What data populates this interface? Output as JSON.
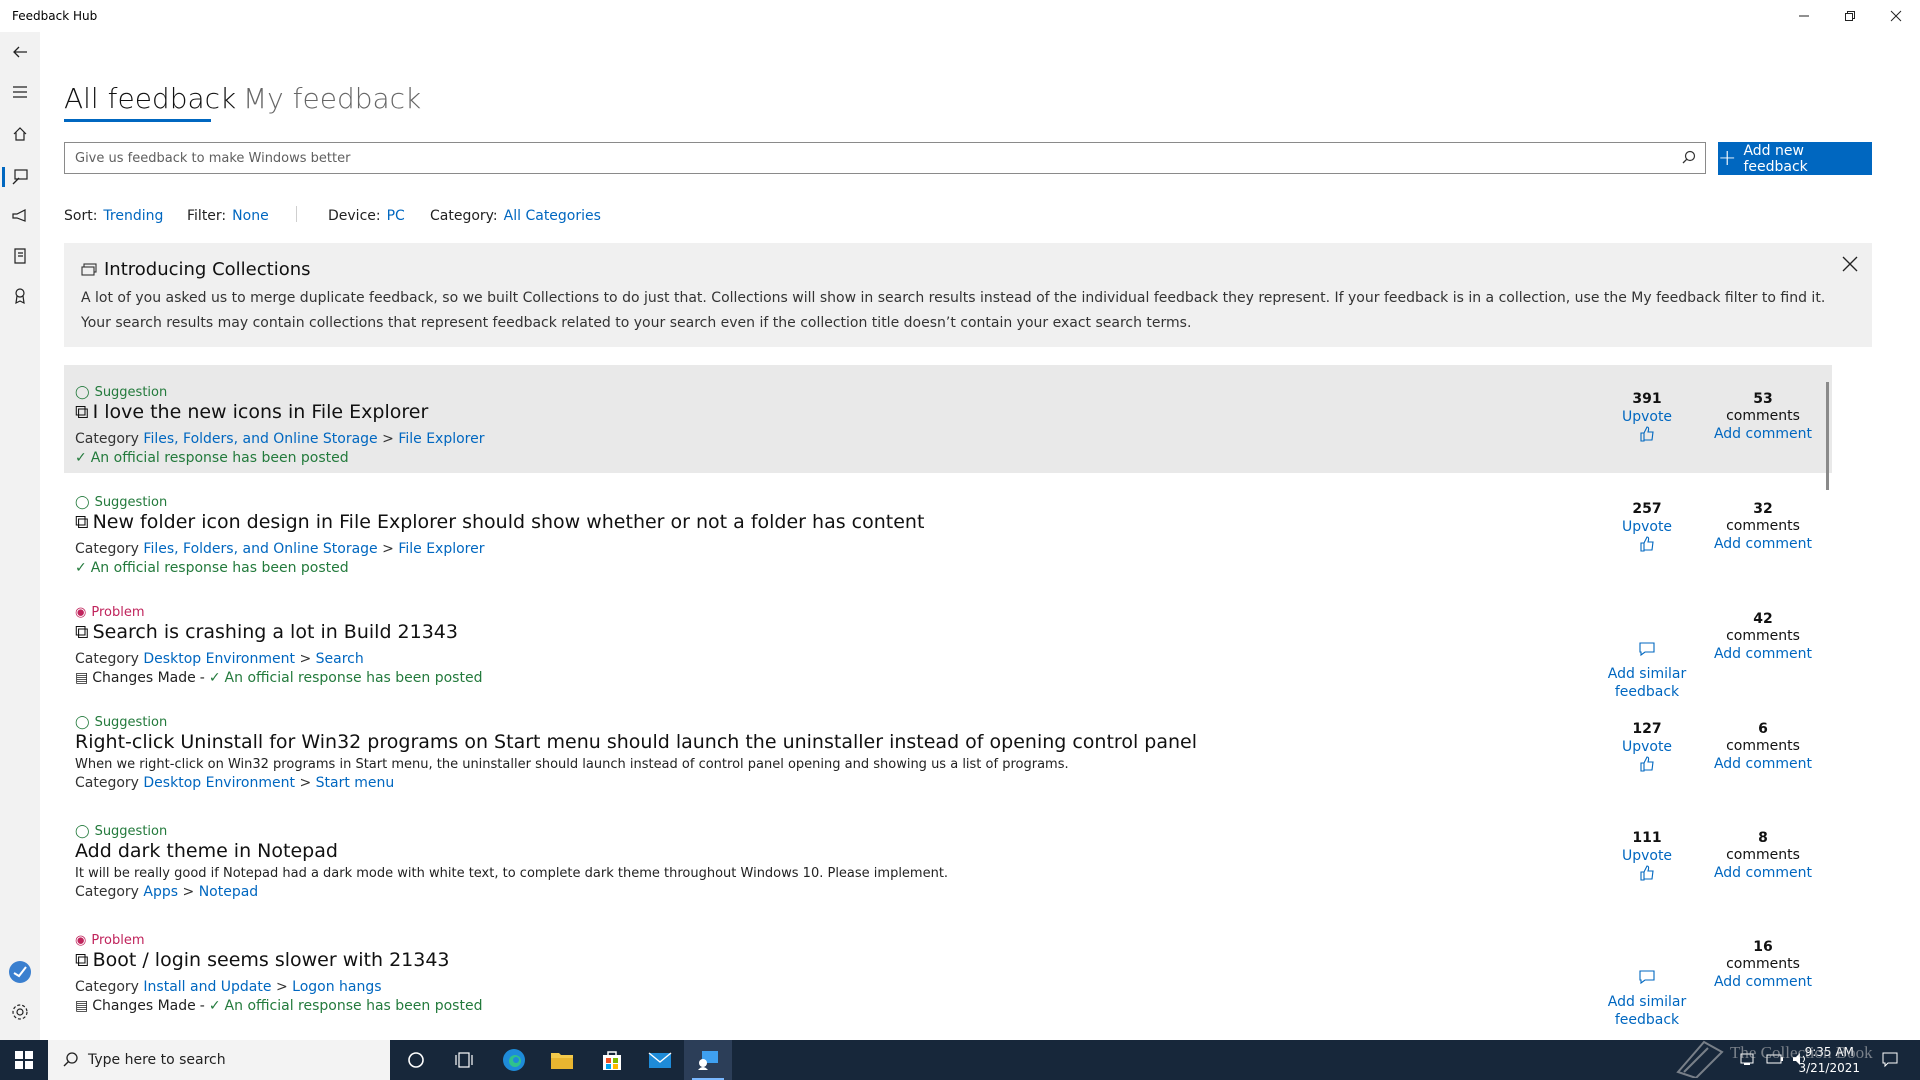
{
  "app": {
    "title": "Feedback Hub"
  },
  "tabs": [
    {
      "label": "All feedback"
    },
    {
      "label": "My feedback"
    }
  ],
  "search": {
    "placeholder": "Give us feedback to make Windows better"
  },
  "add_button": {
    "label": "Add new feedback"
  },
  "filters": {
    "sort": {
      "label": "Sort:",
      "value": "Trending"
    },
    "filter": {
      "label": "Filter:",
      "value": "None"
    },
    "device": {
      "label": "Device:",
      "value": "PC"
    },
    "category": {
      "label": "Category:",
      "value": "All Categories"
    }
  },
  "banner": {
    "title": "Introducing Collections",
    "line1": "A lot of you asked us to merge duplicate feedback, so we built Collections to do just that. Collections will show in search results instead of the individual feedback they represent. If your feedback is in a collection, use the My feedback filter to find it.",
    "line2": "Your search results may contain collections that represent feedback related to your search even if the collection title doesn’t contain your exact search terms."
  },
  "labels": {
    "category": "Category",
    "separator": ">",
    "upvote": "Upvote",
    "comments": "comments",
    "add_comment": "Add comment",
    "add_similar_1": "Add similar",
    "add_similar_2": "feedback",
    "official": "An official response has been posted",
    "changes_made": "Changes Made",
    "dash": "-"
  },
  "feedback": [
    {
      "type": "Suggestion",
      "title": "I love the new icons in File Explorer",
      "cat1": "Files, Folders, and Online Storage",
      "cat2": "File Explorer",
      "upvotes": "391",
      "comments": "53"
    },
    {
      "type": "Suggestion",
      "title": "New folder icon design in File Explorer should show whether or not a folder has content",
      "cat1": "Files, Folders, and Online Storage",
      "cat2": "File Explorer",
      "upvotes": "257",
      "comments": "32"
    },
    {
      "type": "Problem",
      "title": "Search is crashing a lot in Build 21343",
      "cat1": "Desktop Environment",
      "cat2": "Search",
      "comments": "42"
    },
    {
      "type": "Suggestion",
      "title": "Right-click Uninstall for Win32 programs on Start menu should launch the uninstaller instead of opening control panel",
      "description": "When we right-click on Win32 programs in Start menu, the uninstaller should launch instead of control panel opening and showing us a list of programs.",
      "cat1": "Desktop Environment",
      "cat2": "Start menu",
      "upvotes": "127",
      "comments": "6"
    },
    {
      "type": "Suggestion",
      "title": "Add dark theme in Notepad",
      "description": "It will be really good if Notepad had a dark mode with white text, to complete dark theme throughout Windows 10. Please implement.",
      "cat1": "Apps",
      "cat2": "Notepad",
      "upvotes": "111",
      "comments": "8"
    },
    {
      "type": "Problem",
      "title": "Boot / login seems slower with 21343",
      "cat1": "Install and Update",
      "cat2": "Logon hangs",
      "comments": "16"
    }
  ],
  "taskbar": {
    "search_placeholder": "Type here to search",
    "time": "9:35 AM",
    "date": "3/21/2021"
  },
  "watermark": "The Collection Book",
  "colors": {
    "accent": "#0067c0",
    "suggestion": "#237a3c",
    "problem": "#c0245c",
    "taskbar": "#17273a"
  }
}
